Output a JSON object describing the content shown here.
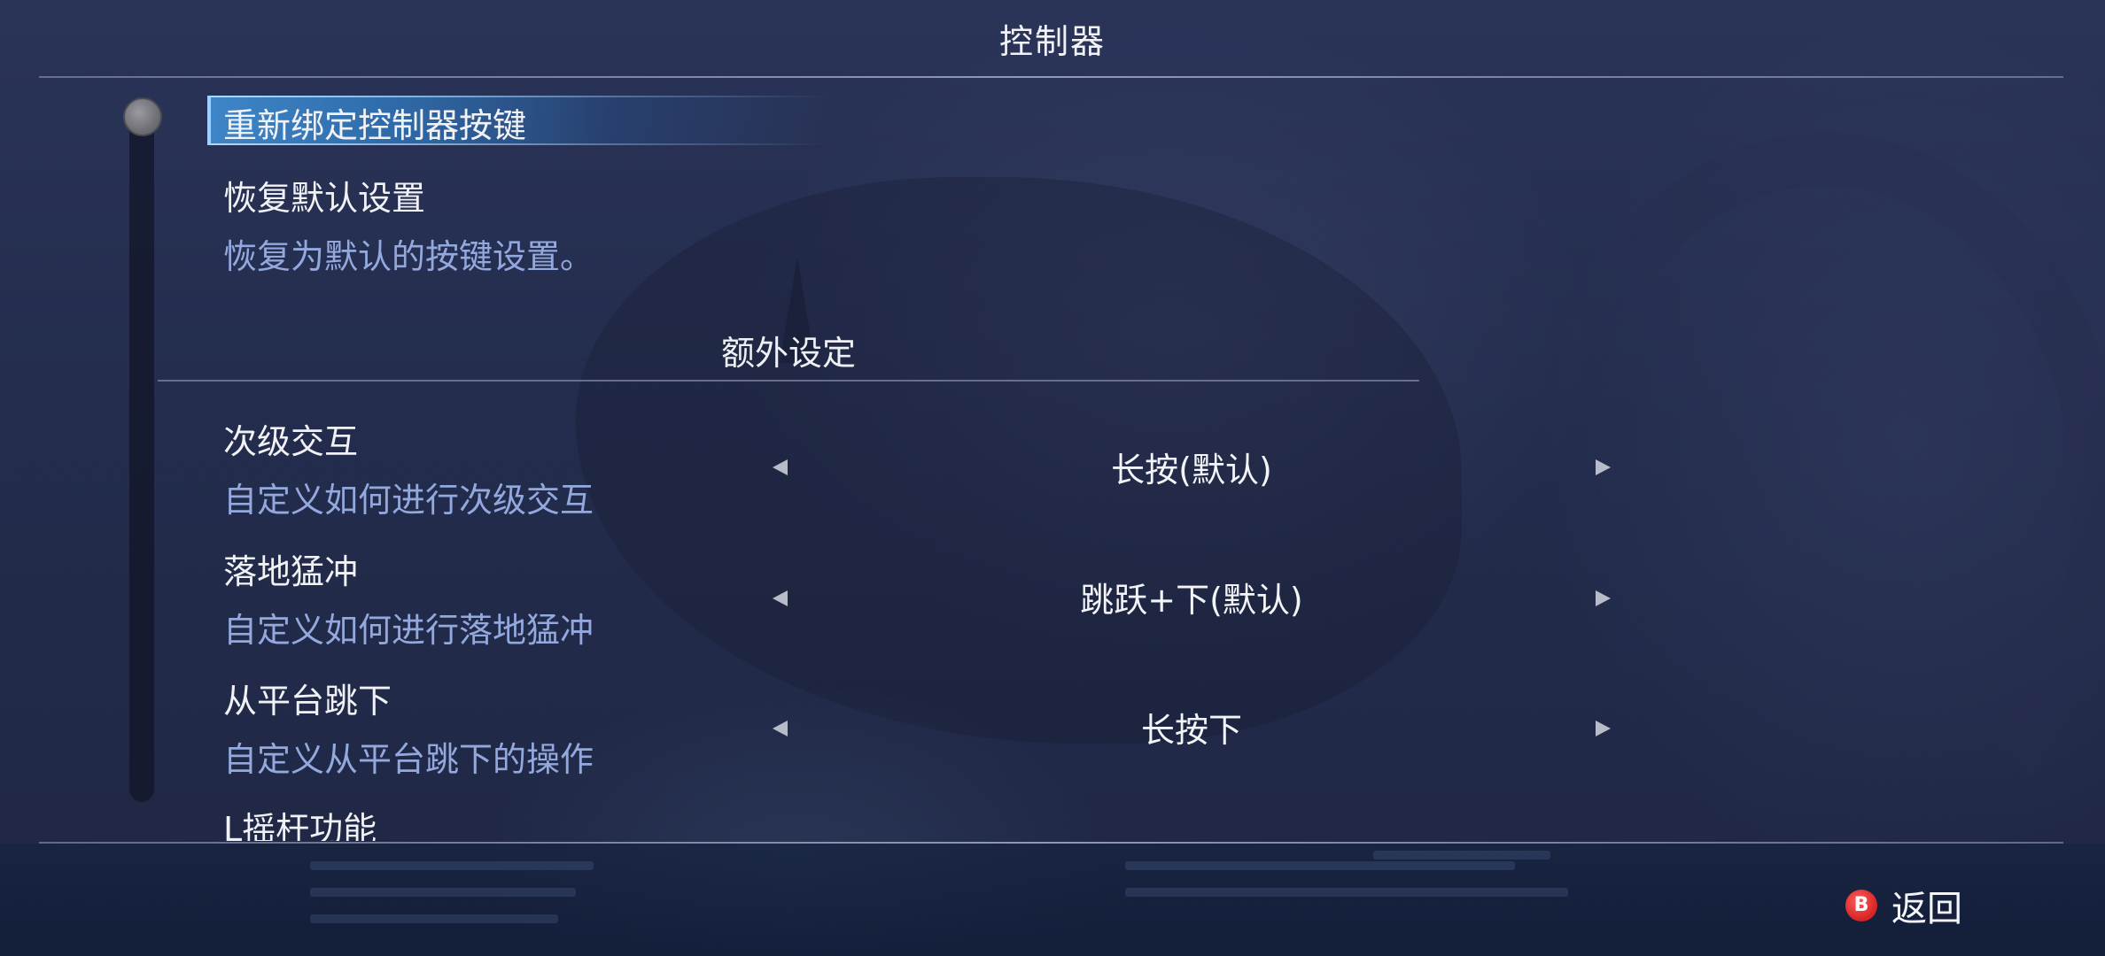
{
  "screen_title": "控制器",
  "menu": {
    "rebind": {
      "label": "重新绑定控制器按键"
    },
    "restore": {
      "label": "恢复默认设置",
      "description": "恢复为默认的按键设置。"
    }
  },
  "section": {
    "title": "额外设定"
  },
  "settings": [
    {
      "label": "次级交互",
      "description": "自定义如何进行次级交互",
      "value": "长按(默认)"
    },
    {
      "label": "落地猛冲",
      "description": "自定义如何进行落地猛冲",
      "value": "跳跃+下(默认)"
    },
    {
      "label": "从平台跳下",
      "description": "自定义从平台跳下的操作",
      "value": "长按下"
    },
    {
      "label": "L摇杆功能",
      "description": "",
      "value": ""
    }
  ],
  "footer": {
    "back_button_glyph": "B",
    "back_label": "返回"
  },
  "colors": {
    "accent": "#3e86c8",
    "description_text": "#93a9de",
    "back_button": "#d42424",
    "background": "#232c4c"
  },
  "icons": {
    "left_arrow": "left-arrow-icon",
    "right_arrow": "right-arrow-icon",
    "back_button": "b-button-icon"
  }
}
